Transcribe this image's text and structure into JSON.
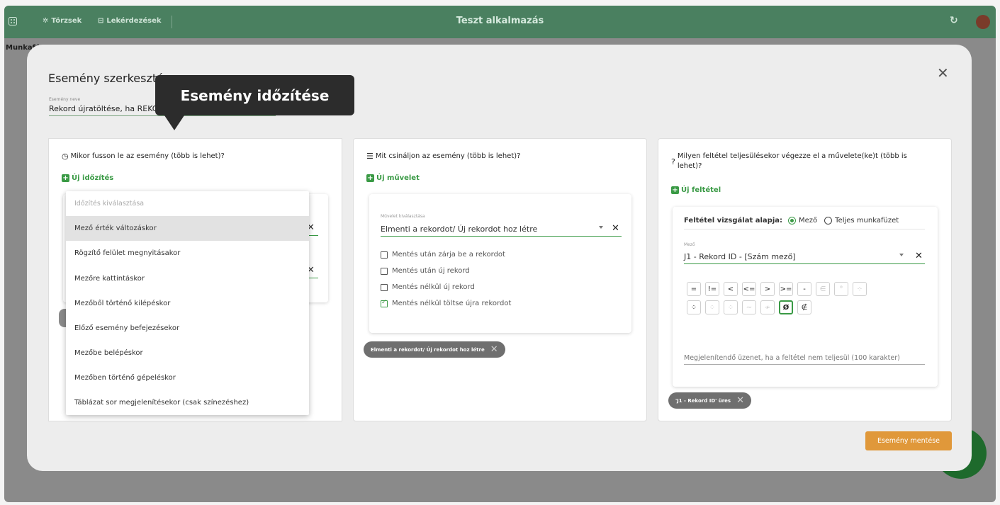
{
  "topbar": {
    "nav_torzsek": "Törzsek",
    "nav_lekerdezesek": "Lekérdezések",
    "app_title": "Teszt alkalmazás"
  },
  "background": {
    "workbook_label": "Munkafü"
  },
  "modal": {
    "title": "Esemény szerkesztése",
    "event_name_label": "Esemény neve",
    "event_name_value": "Rekord újratöltése, ha REKORD ID üres",
    "save_button": "Esemény mentése"
  },
  "tooltip": {
    "text": "Esemény időzítése"
  },
  "panel_when": {
    "heading": "Mikor fusson le az esemény (több is lehet)?",
    "add_label": "Új időzítés"
  },
  "dropdown": {
    "placeholder": "Időzítés kiválasztása",
    "items": [
      "Mező érték változáskor",
      "Rögzítő felület megnyitásakor",
      "Mezőre kattintáskor",
      "Mezőből történő kilépéskor",
      "Előző esemény befejezésekor",
      "Mezőbe belépéskor",
      "Mezőben történő gépeléskor",
      "Táblázat sor megjelenítésekor (csak színezéshez)"
    ]
  },
  "panel_what": {
    "heading": "Mit csináljon az esemény (több is lehet)?",
    "add_label": "Új művelet",
    "action_label": "Művelet kiválasztása",
    "action_value": "Elmenti a rekordot/ Új rekordot hoz létre",
    "checkboxes": [
      {
        "label": "Mentés után zárja be a rekordot",
        "checked": false
      },
      {
        "label": "Mentés után új rekord",
        "checked": false
      },
      {
        "label": "Mentés nélkül új rekord",
        "checked": false
      },
      {
        "label": "Mentés nélkül töltse újra rekordot",
        "checked": true
      }
    ],
    "chip": "Elmenti a rekordot/ Új rekordot hoz létre"
  },
  "panel_condition": {
    "heading": "Milyen feltétel teljesülésekor végezze el a művelete(ke)t (több is lehet)?",
    "add_label": "Új feltétel",
    "basis_label": "Feltétel vizsgálat alapja:",
    "radio_field": "Mező",
    "radio_workbook": "Teljes munkafüzet",
    "field_label": "Mező",
    "field_value": "J1 - Rekord ID - [Szám mező]",
    "operators_row1": [
      "=",
      "!=",
      "<",
      "<=",
      ">",
      ">=",
      "-",
      "∈",
      "°",
      "⁘"
    ],
    "operators_row2": [
      "⁘",
      "⁘",
      "⁘",
      "~",
      "≁",
      "Ø",
      "∉"
    ],
    "message_placeholder": "Megjelenítendő üzenet, ha a feltétel nem teljesül (100 karakter)",
    "chip": "'J1 - Rekord ID' üres"
  },
  "colors": {
    "topbar": "#4a8060",
    "accent_green": "#3a9a45",
    "save_orange": "#e0983a",
    "tooltip_bg": "#2c2c2c"
  }
}
